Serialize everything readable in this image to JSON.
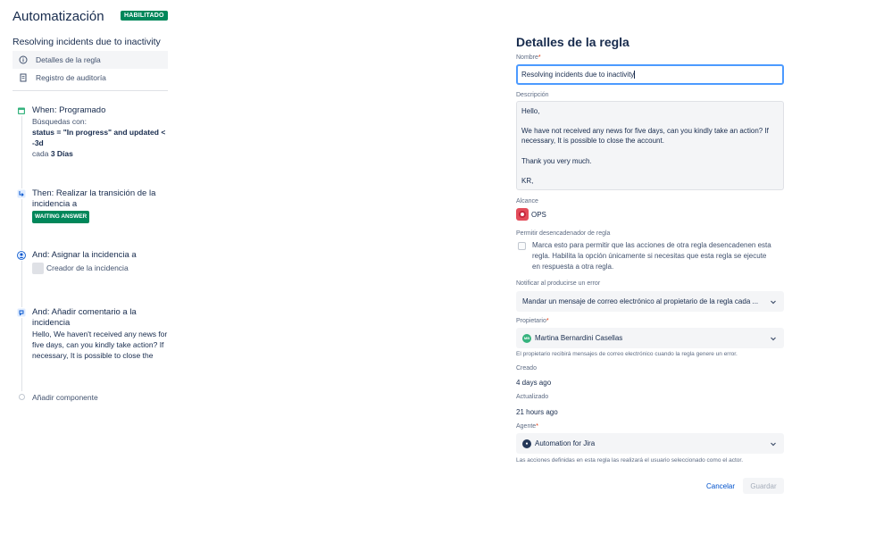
{
  "header": {
    "title": "Automatización",
    "status_badge": "HABILITADO"
  },
  "sidebar": {
    "rule_name": "Resolving incidents due to inactivity",
    "nav": [
      {
        "label": "Detalles de la regla",
        "icon": "info-icon"
      },
      {
        "label": "Registro de auditoría",
        "icon": "document-icon"
      }
    ],
    "steps": {
      "when": {
        "title": "When: Programado",
        "line1": "Búsquedas con:",
        "query_a": "status = \"In progress\" and updated <",
        "query_b": "-3d",
        "freq_prefix": "cada",
        "freq_value": "3 Días"
      },
      "then": {
        "title_a": "Then: Realizar la transición de la",
        "title_b": "incidencia a",
        "status": "WAITING ANSWER"
      },
      "assign": {
        "title": "And: Asignar la incidencia a",
        "assignee": "Creador de la incidencia"
      },
      "comment": {
        "title_a": "And: Añadir comentario a la",
        "title_b": "incidencia",
        "text_1": "Hello, We haven't received any news for",
        "text_2": "five days, can you kindly take action? If",
        "text_3": "necessary, It is possible to close the"
      }
    },
    "add_component": "Añadir componente"
  },
  "details": {
    "title": "Detalles de la regla",
    "name_label": "Nombre",
    "name_value": "Resolving incidents due to inactivity",
    "description_label": "Descripción",
    "description_lines": [
      "Hello,",
      "",
      "We have not received any news for five days, can you kindly take an action? If",
      "necessary, It is possible to close the account.",
      "",
      "Thank you very much.",
      "",
      "KR,"
    ],
    "scope_label": "Alcance",
    "scope_value": "OPS",
    "trigger_label": "Permitir desencadenador de regla",
    "trigger_checkbox_text_1": "Marca esto para permitir que las acciones de otra regla desencadenen esta",
    "trigger_checkbox_text_2": "regla. Habilita la opción únicamente si necesitas que esta regla se ejecute",
    "trigger_checkbox_text_3": "en respuesta a otra regla.",
    "notify_label": "Notificar al producirse un error",
    "notify_value": "Mandar un mensaje de correo electrónico al propietario de la regla cada ...",
    "owner_label": "Propietario",
    "owner_value": "Martina Bernardini Casellas",
    "owner_initials": "MB",
    "owner_helper": "El propietario recibirá mensajes de correo electrónico cuando la regla genere un error.",
    "created_label": "Creado",
    "created_value": "4 days ago",
    "updated_label": "Actualizado",
    "updated_value": "21 hours ago",
    "agent_label": "Agente",
    "agent_value": "Automation for Jira",
    "agent_helper": "Las acciones definidas en esta regla las realizará el usuario seleccionado como el actor.",
    "cancel_label": "Cancelar",
    "save_label": "Guardar"
  },
  "colors": {
    "accent": "#0052cc",
    "success": "#00875a",
    "focus": "#4c9aff"
  }
}
